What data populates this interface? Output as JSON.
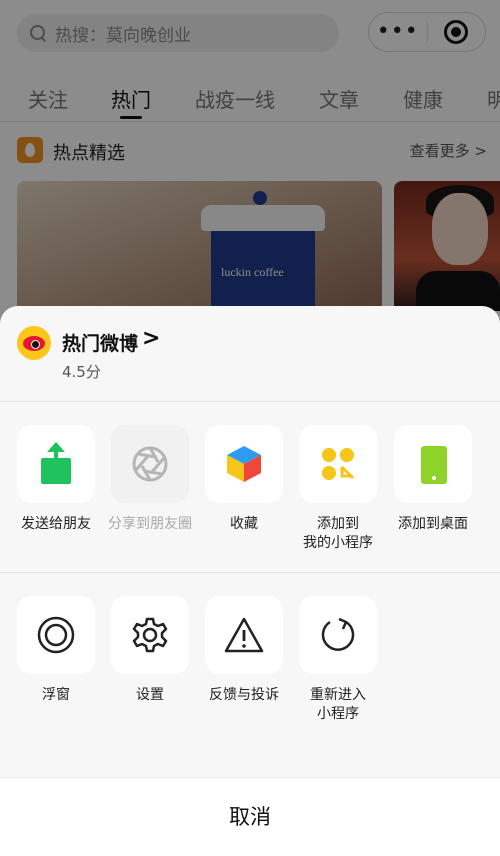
{
  "background_page": {
    "search": {
      "placeholder": "热搜：莫向晚创业"
    },
    "tabs": [
      {
        "label": "关注"
      },
      {
        "label": "热门",
        "active": true
      },
      {
        "label": "战疫一线"
      },
      {
        "label": "文章"
      },
      {
        "label": "健康"
      },
      {
        "label": "明"
      }
    ],
    "section": {
      "title": "热点精选",
      "more": "查看更多 >"
    },
    "cards": [
      {
        "brand_text": "luckin coffee"
      },
      {
        "brand_text": ""
      }
    ]
  },
  "sheet": {
    "app": {
      "name": "热门微博",
      "rating": "4.5分",
      "arrow": ">"
    },
    "row1": [
      {
        "label": "发送给朋友",
        "icon": "share-upload-icon",
        "disabled": false
      },
      {
        "label": "分享到朋友圈",
        "icon": "moments-shutter-icon",
        "disabled": true
      },
      {
        "label": "收藏",
        "icon": "favorite-cube-icon",
        "disabled": false
      },
      {
        "label": "添加到我的小程序",
        "label_line1": "添加到",
        "label_line2": "我的小程序",
        "icon": "add-miniprogram-icon",
        "disabled": false
      },
      {
        "label": "添加到桌面",
        "icon": "add-to-desktop-icon",
        "disabled": false
      }
    ],
    "row2": [
      {
        "label": "浮窗",
        "icon": "floating-window-icon"
      },
      {
        "label": "设置",
        "icon": "settings-gear-icon"
      },
      {
        "label": "反馈与投诉",
        "icon": "warning-triangle-icon"
      },
      {
        "label": "重新进入小程序",
        "label_line1": "重新进入",
        "label_line2": "小程序",
        "icon": "reload-icon"
      }
    ],
    "cancel_label": "取消"
  },
  "colors": {
    "accent_green": "#1fc25f",
    "yellow": "#f5c518",
    "light_green": "#8fd32a",
    "weibo_yellow": "#ffc61a",
    "weibo_red": "#e6162d"
  }
}
